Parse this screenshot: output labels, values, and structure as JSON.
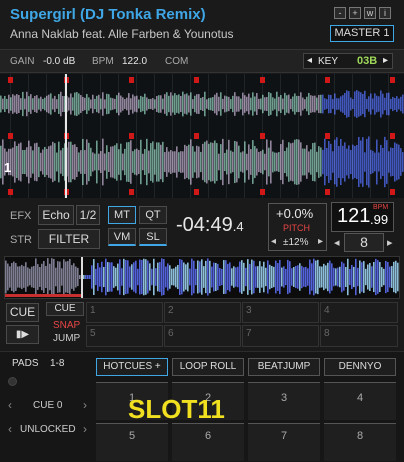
{
  "deck": {
    "title": "Supergirl (DJ Tonka Remix)",
    "artist": "Anna Naklab feat. Alle Farben & Younotus",
    "window_buttons": [
      "-",
      "+",
      "w",
      "i"
    ],
    "master_label": "MASTER 1"
  },
  "info": {
    "gain_label": "GAIN",
    "gain_value": "-0.0 dB",
    "bpm_label": "BPM",
    "bpm_value": "122.0",
    "com_label": "COM",
    "key_label": "KEY",
    "key_value": "03B",
    "key_prev": "◂",
    "key_next": "▸"
  },
  "waveform": {
    "beat_marker": "1"
  },
  "controls": {
    "efx_label": "EFX",
    "echo_label": "Echo",
    "fraction_label": "1/2",
    "mt_label": "MT",
    "qt_label": "QT",
    "vm_label": "VM",
    "sl_label": "SL",
    "str_label": "STR",
    "filter_label": "FILTER",
    "time_main": "-04:49",
    "time_frac": ".4",
    "pitch_value": "+0.0%",
    "pitch_label": "PITCH",
    "pitch_range": "±12%",
    "pitch_down": "◂",
    "pitch_up": "▸",
    "bpm_main": "121",
    "bpm_frac": ".99",
    "bpm_tag": "BPM",
    "loop_value": "8",
    "loop_prev": "◂",
    "loop_next": "▸"
  },
  "transport": {
    "cue_label": "CUE",
    "play_label": "▮▶",
    "cue_small": "CUE",
    "snap_label": "SNAP",
    "jump_label": "JUMP",
    "pad_numbers": [
      "1",
      "2",
      "3",
      "4",
      "5",
      "6",
      "7",
      "8"
    ]
  },
  "pads": {
    "pads_label": "PADS",
    "pads_range": "1-8",
    "cue_selector": "CUE 0",
    "unlocked_label": "UNLOCKED",
    "tabs": [
      "HOTCUES +",
      "LOOP ROLL",
      "BEATJUMP",
      "DENNYO"
    ],
    "pad_numbers": [
      "1",
      "2",
      "3",
      "4",
      "5",
      "6",
      "7",
      "8"
    ],
    "slot_label": "SLOT11"
  },
  "colors": {
    "accent": "#3fa7e6",
    "key": "#9fd85a",
    "snap": "#e84545",
    "pitch": "#e84545",
    "slot": "#f0e020",
    "marker": "#d01818"
  }
}
